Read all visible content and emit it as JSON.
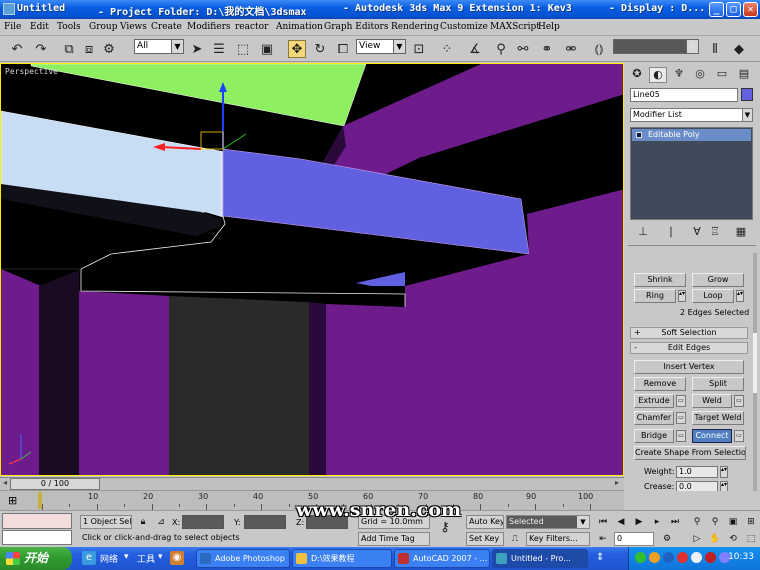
{
  "window": {
    "title_left": "Untitled",
    "title_mid": "- Project Folder: D:\\我的文档\\3dsmax",
    "title_right": "- Autodesk 3ds Max 9 Extension 1: Kev3",
    "title_tail": "- Display : D...",
    "min": "_",
    "max": "□",
    "close": "✕"
  },
  "menu": [
    "File",
    "Edit",
    "Tools",
    "Group",
    "Views",
    "Create",
    "Modifiers",
    "reactor",
    "Animation",
    "Graph Editors",
    "Rendering",
    "Customize",
    "MAXScript",
    "Help"
  ],
  "toolbar": {
    "selection_filter": "All",
    "ref_coord": "View",
    "named_selection": ""
  },
  "viewport": {
    "label": "Perspective",
    "colors": {
      "background": "#000000",
      "border_active": "#ffea00",
      "beam_blue": "#6060e0",
      "wall_purple": "#6e1c8c",
      "beam_light": "#c8dcf4",
      "beam_green": "#8ef060"
    }
  },
  "command_panel": {
    "object_name": "Line05",
    "object_color": "#6060e0",
    "modifier_list": "Modifier List",
    "stack_item": "Editable Poly",
    "selection": {
      "shrink": "Shrink",
      "grow": "Grow",
      "ring": "Ring",
      "loop": "Loop",
      "status": "2 Edges Selected"
    },
    "soft_selection": "Soft Selection",
    "edit_edges": "Edit Edges",
    "buttons": {
      "insert_vertex": "Insert Vertex",
      "remove": "Remove",
      "split": "Split",
      "extrude": "Extrude",
      "weld": "Weld",
      "chamfer": "Chamfer",
      "target_weld": "Target Weld",
      "bridge": "Bridge",
      "connect": "Connect",
      "create_shape": "Create Shape From Selection"
    },
    "weight_label": "Weight:",
    "weight_value": "1.0",
    "crease_label": "Crease:",
    "crease_value": "0.0"
  },
  "timeline": {
    "frame": "0 / 100",
    "ticks": [
      "10",
      "20",
      "30",
      "40",
      "50",
      "60",
      "70",
      "80",
      "90",
      "100"
    ]
  },
  "status": {
    "selection_count": "1 Object Sele",
    "x_label": "X:",
    "y_label": "Y:",
    "z_label": "Z:",
    "grid": "Grid = 10.0mm",
    "auto_key": "Auto Key",
    "set_key": "Set Key",
    "key_mode": "Selected",
    "key_filters": "Key Filters...",
    "frame_field": "0",
    "prompt": "Click or click-and-drag to select objects",
    "add_time_tag": "Add Time Tag"
  },
  "watermark": "www.snren.com",
  "taskbar": {
    "start": "开始",
    "network": "网络",
    "tools": "工具",
    "tasks": [
      "Adobe Photoshop",
      "D:\\效果教程",
      "AutoCAD 2007 - ...",
      "Untitled - Pro..."
    ],
    "clock": "10:33"
  }
}
